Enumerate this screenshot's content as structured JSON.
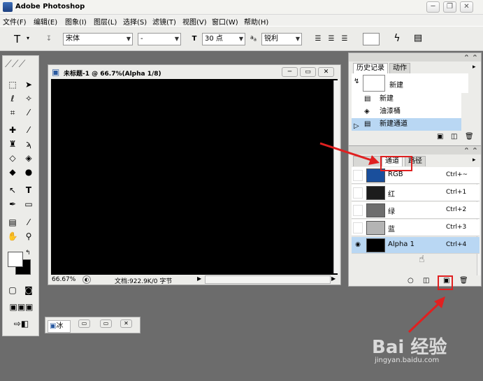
{
  "app": {
    "title": "Adobe Photoshop"
  },
  "window_controls": {
    "minimize": "─",
    "restore": "❐",
    "close": "✕"
  },
  "menu": [
    "文件(F)",
    "编辑(E)",
    "图象(I)",
    "图层(L)",
    "选择(S)",
    "滤镜(T)",
    "视图(V)",
    "窗口(W)",
    "帮助(H)"
  ],
  "options": {
    "tool_glyph": "T",
    "font_family": "宋体",
    "font_style": "-",
    "font_size": "30 点",
    "aa_prefix": "a",
    "aa_suffix": "a",
    "antialias": "锐利"
  },
  "document": {
    "title": "未标题-1 @ 66.7%(Alpha 1/8)",
    "zoom": "66.67%",
    "doc_info": "文档:922.9K/0 字节"
  },
  "history_panel": {
    "tabs": [
      "历史记录",
      "动作"
    ],
    "snapshot_label": "新建",
    "items": [
      "新建",
      "油漆桶",
      "新建通道"
    ]
  },
  "channels_panel": {
    "tabs": [
      "通道",
      "路径"
    ],
    "channels": [
      {
        "name": "RGB",
        "shortcut": "Ctrl+~",
        "color": "#1a4f9c",
        "visible": false
      },
      {
        "name": "红",
        "shortcut": "Ctrl+1",
        "color": "#1c1c1c",
        "visible": false
      },
      {
        "name": "绿",
        "shortcut": "Ctrl+2",
        "color": "#6d6d6d",
        "visible": false
      },
      {
        "name": "蓝",
        "shortcut": "Ctrl+3",
        "color": "#b4b4b4",
        "visible": false
      },
      {
        "name": "Alpha 1",
        "shortcut": "Ctrl+4",
        "color": "#000000",
        "visible": true
      }
    ]
  },
  "dock": {
    "tab_label": "冰"
  },
  "watermark": {
    "main": "Bai 经验",
    "sub": "jingyan.baidu.com"
  },
  "colors": {
    "highlight_red": "#e02020",
    "selection_blue": "#b9d7f3"
  }
}
